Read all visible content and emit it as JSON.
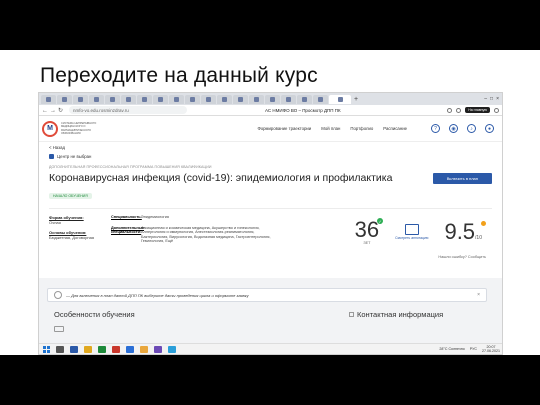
{
  "slide": {
    "title": "Переходите на данный курс"
  },
  "browser": {
    "url": "nmfo-vo.edu.rosminzdrav.ru",
    "page_title": "АС НМИФО ВО – Просмотр ДПП ПК",
    "profile_label": "На главную"
  },
  "site": {
    "logo_letter": "M",
    "logo_text": "СИСТЕМА НЕПРЕРЫВНОГО МЕДИЦИНСКОГО И ФАРМАЦЕВТИЧЕСКОГО ОБРАЗОВАНИЯ",
    "nav": [
      "Формирование траектории",
      "Мой план",
      "Портфолио",
      "Расписание"
    ]
  },
  "page": {
    "back": "< Назад",
    "center": "Центр не выбран",
    "program_type": "ДОПОЛНИТЕЛЬНАЯ ПРОФЕССИОНАЛЬНАЯ ПРОГРАММА ПОВЫШЕНИЯ КВАЛИФИКАЦИИ",
    "title": "Коронавирусная инфекция (covid-19): эпидемиология и профилактика",
    "enroll_button": "Включить в план",
    "badge": "НАЧАЛО ОБУЧЕНИЯ",
    "form_label": "Форма обучения:",
    "form_value": "Очная",
    "basis_label": "Основы обучения:",
    "basis_value": "Бюджетная, Договорная",
    "specialty_label": "Специальность:",
    "specialty_value": "Эпидемиология",
    "extra_label": "Дополнительные специальности:",
    "extra_value": "Авиационная и космическая медицина, Акушерство и гинекология, Аллергология и иммунология, Анестезиология-реаниматология, Бактериология, Вирусология, Водолазная медицина, Гастроэнтерология, Гематология, Ещё",
    "hours": "36",
    "hours_unit": "ЗЕТ",
    "book_label": "Смотреть аннотацию",
    "score": "9.5",
    "score_den": "/10",
    "report_error": "Нашли ошибку? Сообщить"
  },
  "lower": {
    "notice": "— Для включения в план данной ДПП ПК выберите даты проведения цикла и оформите заявку",
    "section_features": "Особенности обучения",
    "section_contact": "Контактная информация"
  },
  "taskbar": {
    "weather": "28°C Солнечно",
    "time": "20:07",
    "date": "27.06.2021",
    "lang": "РУС"
  }
}
